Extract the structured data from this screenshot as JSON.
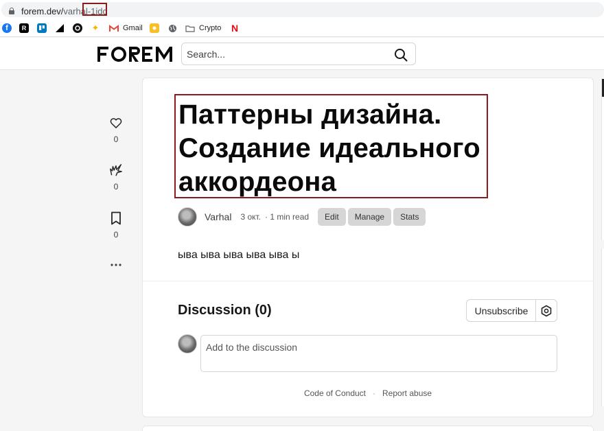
{
  "browser": {
    "url_host": "forem.dev/",
    "url_path": "varhal",
    "url_highlight": "-1idc",
    "bookmarks": [
      {
        "icon": "facebook-icon",
        "label": "",
        "color": "#1877f2"
      },
      {
        "icon": "r-app-icon",
        "label": "",
        "color": "#000000"
      },
      {
        "icon": "trello-icon",
        "label": "",
        "color": "#0079bf"
      },
      {
        "icon": "triangle-icon",
        "label": "",
        "color": "#000000"
      },
      {
        "icon": "circle-app-icon",
        "label": "",
        "color": "#111111"
      },
      {
        "icon": "sparkle-icon",
        "label": "",
        "color": "#f4b400"
      },
      {
        "icon": "gmail-icon",
        "label": "Gmail",
        "color": "#ea4335"
      },
      {
        "icon": "yellow-app-icon",
        "label": "",
        "color": "#f6c026"
      },
      {
        "icon": "globe-icon",
        "label": "",
        "color": "#5f6368"
      },
      {
        "icon": "folder-icon",
        "label": "Crypto",
        "color": "#5f6368"
      },
      {
        "icon": "netflix-icon",
        "label": "",
        "color": "#e50914"
      }
    ]
  },
  "header": {
    "logo_text": "FOREM",
    "search_placeholder": "Search..."
  },
  "reactions": [
    {
      "icon": "heart-icon",
      "count": "0"
    },
    {
      "icon": "unicorn-icon",
      "count": "0"
    },
    {
      "icon": "bookmark-icon",
      "count": "0"
    },
    {
      "icon": "more-icon",
      "count": ""
    }
  ],
  "article": {
    "title": "Паттерны дизайна. Создание идеального аккордеона",
    "author": "Varhal",
    "date": "3 окт.",
    "read_time": "· 1 min read",
    "actions": [
      "Edit",
      "Manage",
      "Stats"
    ],
    "body": "ыва ыва ыва ыва ыва ы"
  },
  "discussion": {
    "title": "Discussion (0)",
    "unsubscribe_label": "Unsubscribe",
    "comment_placeholder": "Add to the discussion"
  },
  "footer": {
    "code_of_conduct": "Code of Conduct",
    "separator": "·",
    "report_abuse": "Report abuse"
  }
}
